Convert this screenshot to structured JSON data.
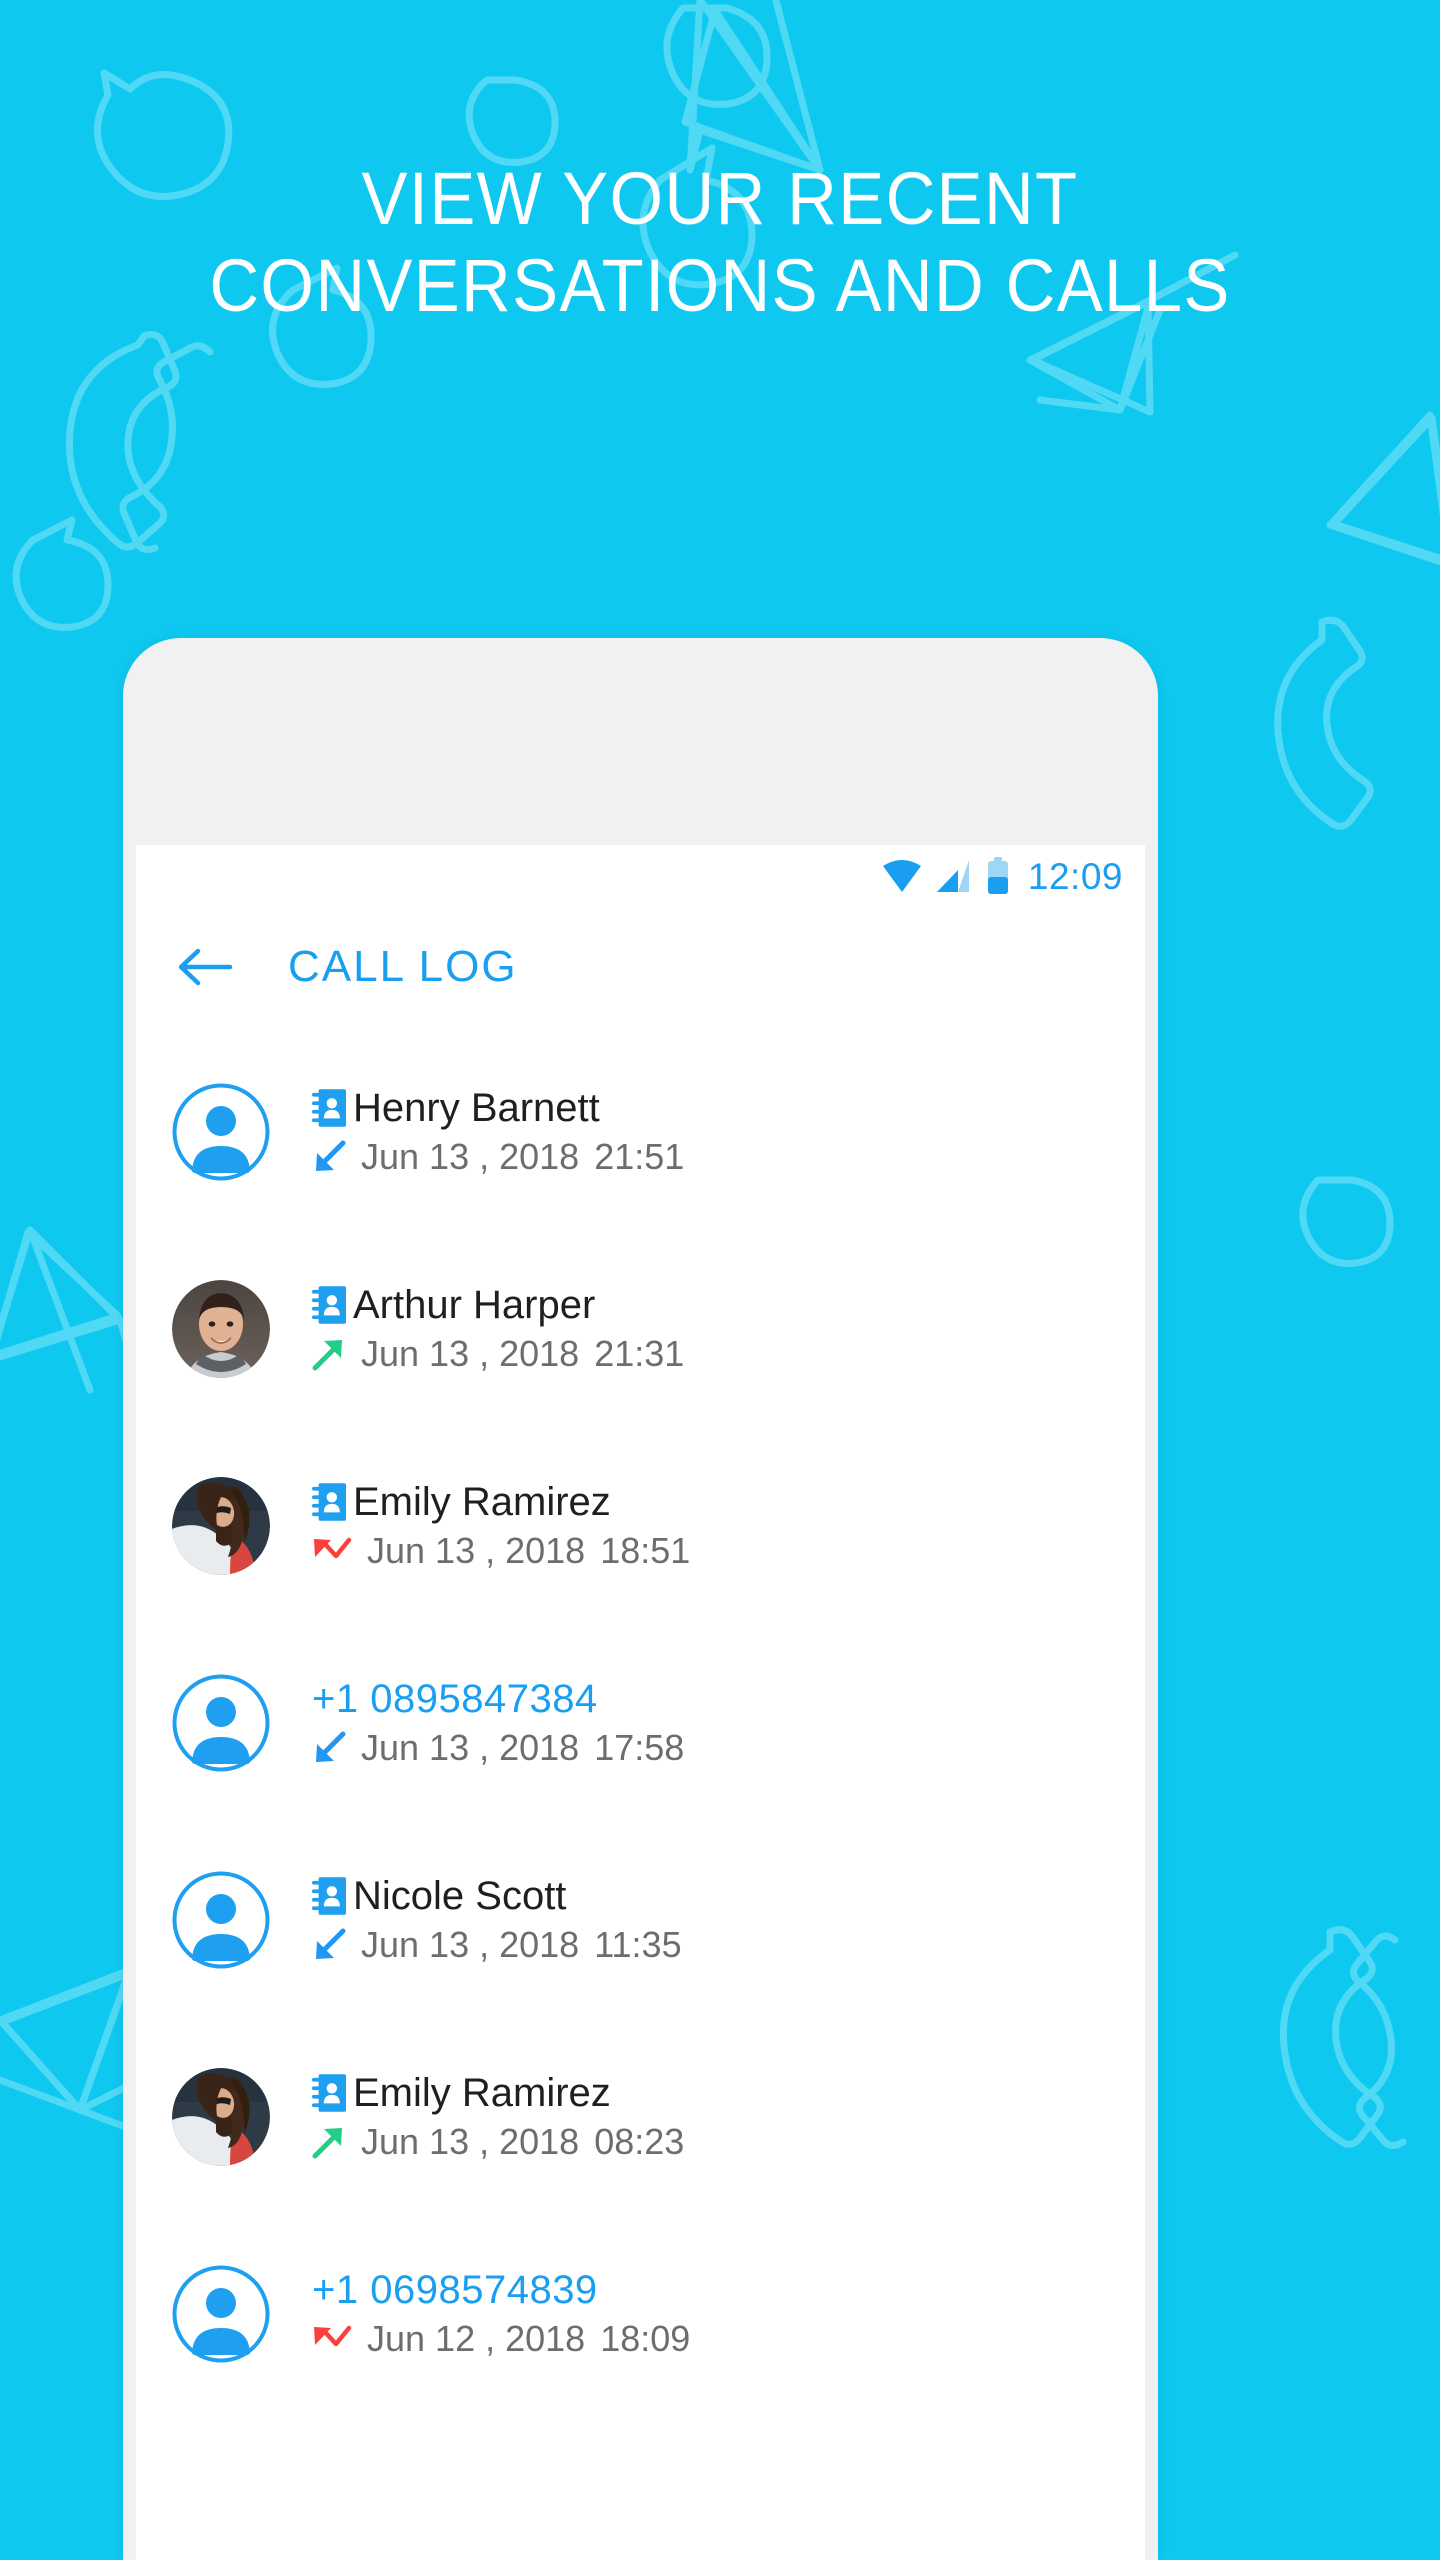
{
  "headline": "VIEW YOUR RECENT\nCONVERSATIONS AND CALLS",
  "colors": {
    "background": "#0fc8ef",
    "accent_blue": "#1a9ff0",
    "incoming": "#2196f3",
    "outgoing": "#23ce86",
    "missed": "#f9403a",
    "text_dark": "#1f1f1f",
    "text_muted": "#6d6d6d"
  },
  "phone": {
    "status_bar": {
      "time": "12:09",
      "icons": [
        "wifi-icon",
        "signal-icon",
        "battery-icon"
      ]
    },
    "app_bar": {
      "back_icon": "arrow-left-icon",
      "title": "CALL LOG"
    },
    "call_log": [
      {
        "name": "Henry Barnett",
        "is_number": false,
        "has_contact_icon": true,
        "avatar": "placeholder",
        "direction": "incoming",
        "date": "Jun 13 , 2018",
        "time": "21:51"
      },
      {
        "name": "Arthur Harper",
        "is_number": false,
        "has_contact_icon": true,
        "avatar": "photo-man",
        "direction": "outgoing",
        "date": "Jun 13 , 2018",
        "time": "21:31"
      },
      {
        "name": "Emily Ramirez",
        "is_number": false,
        "has_contact_icon": true,
        "avatar": "photo-woman",
        "direction": "missed",
        "date": "Jun 13 , 2018",
        "time": "18:51"
      },
      {
        "name": "+1 0895847384",
        "is_number": true,
        "has_contact_icon": false,
        "avatar": "placeholder",
        "direction": "incoming",
        "date": "Jun 13 , 2018",
        "time": "17:58"
      },
      {
        "name": "Nicole Scott",
        "is_number": false,
        "has_contact_icon": true,
        "avatar": "placeholder",
        "direction": "incoming",
        "date": "Jun 13 , 2018",
        "time": "11:35"
      },
      {
        "name": "Emily Ramirez",
        "is_number": false,
        "has_contact_icon": true,
        "avatar": "photo-woman",
        "direction": "outgoing",
        "date": "Jun 13 , 2018",
        "time": "08:23"
      },
      {
        "name": "+1 0698574839",
        "is_number": true,
        "has_contact_icon": false,
        "avatar": "placeholder",
        "direction": "missed",
        "date": "Jun 12 , 2018",
        "time": "18:09"
      }
    ]
  }
}
